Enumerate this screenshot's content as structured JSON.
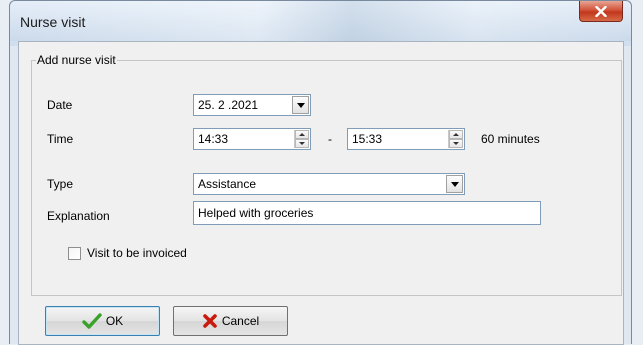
{
  "window": {
    "title": "Nurse visit",
    "close_icon": "close-icon"
  },
  "group": {
    "legend": "Add nurse visit"
  },
  "form": {
    "date_label": "Date",
    "date_value": "25. 2 .2021",
    "time_label": "Time",
    "time_start": "14:33",
    "time_separator": "-",
    "time_end": "15:33",
    "duration": "60 minutes",
    "type_label": "Type",
    "type_value": "Assistance",
    "explanation_label": "Explanation",
    "explanation_value": "Helped with groceries",
    "invoice_label": "Visit to be invoiced",
    "invoice_checked": false
  },
  "buttons": {
    "ok_label": "OK",
    "ok_icon": "checkmark-icon",
    "cancel_label": "Cancel",
    "cancel_icon": "x-mark-icon"
  },
  "colors": {
    "ok_icon": "#3aa12a",
    "cancel_icon": "#c81a0e",
    "close_button": "#c9402a"
  }
}
